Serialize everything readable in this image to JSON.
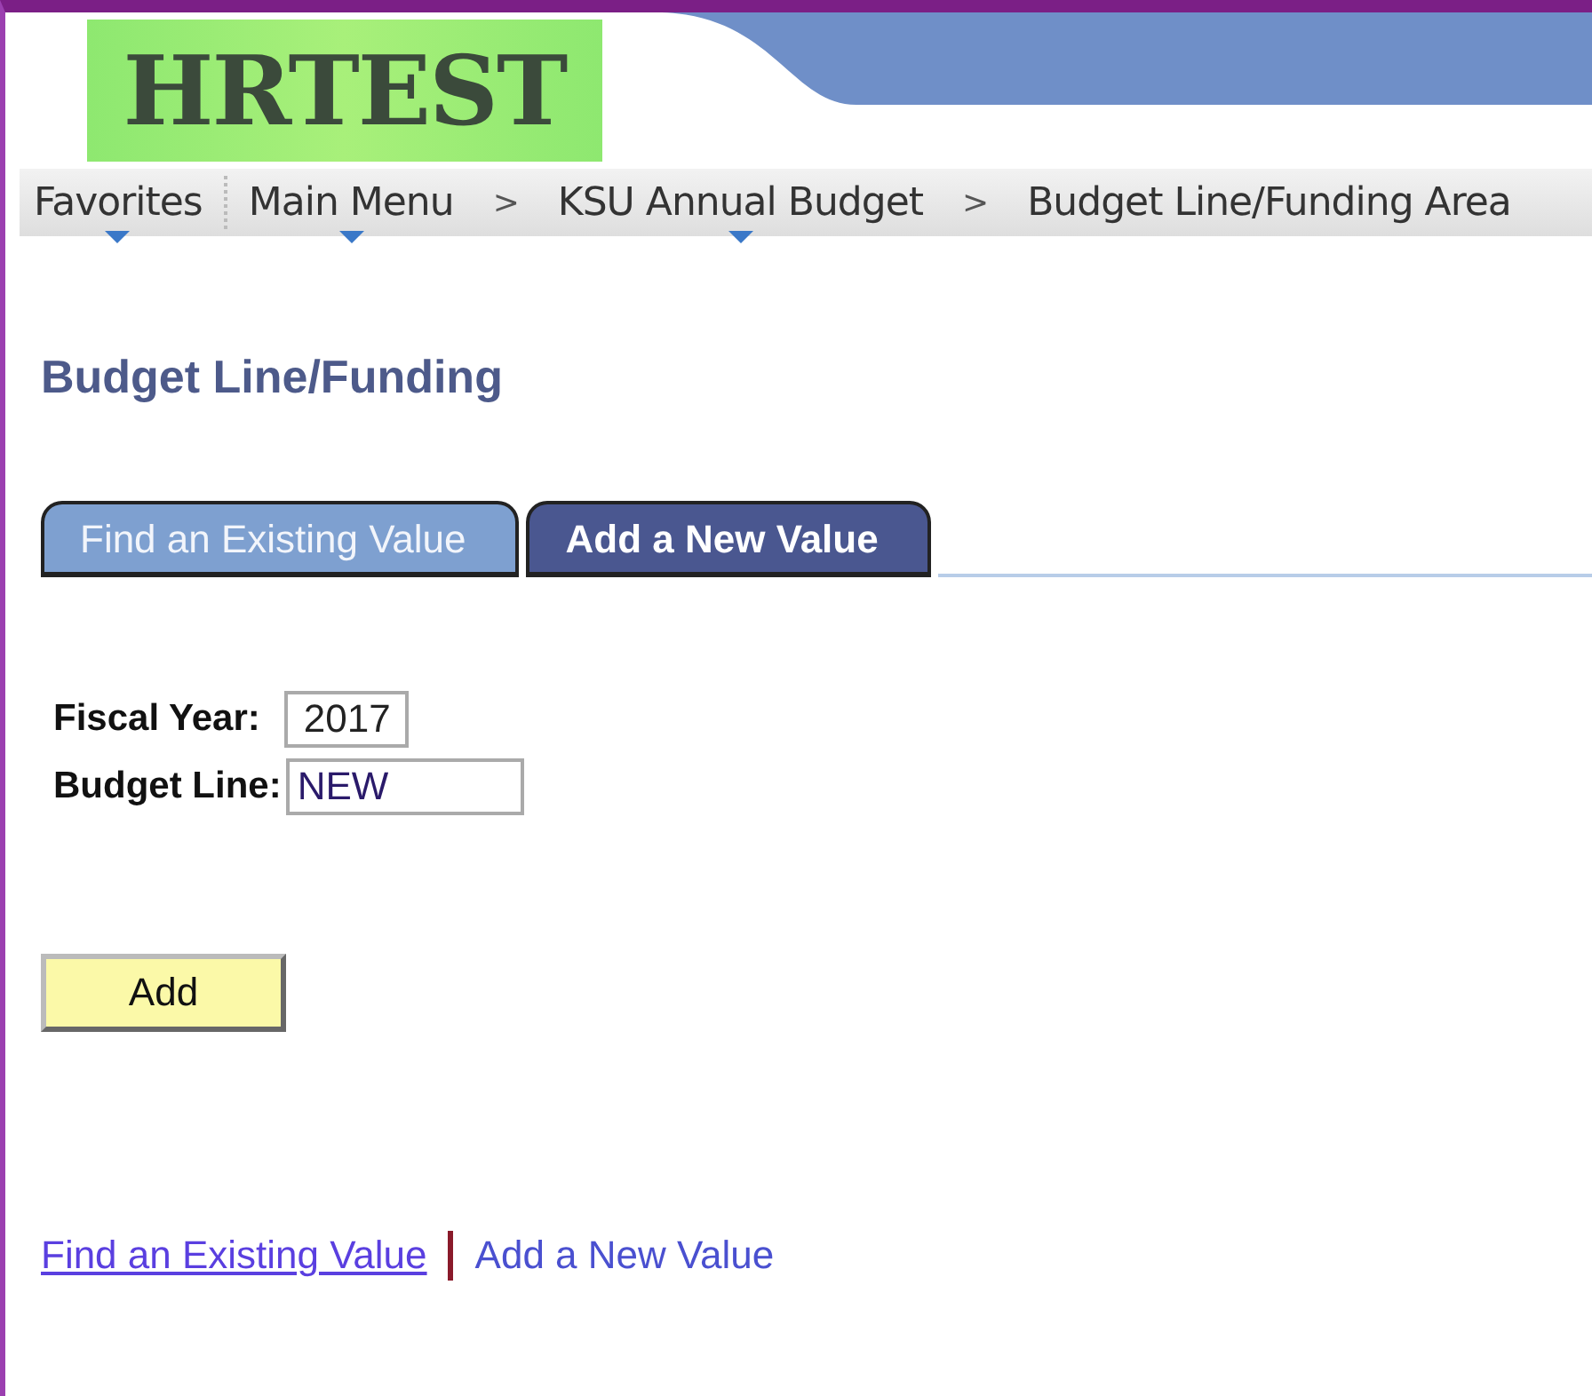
{
  "logo": {
    "text": "HRTEST"
  },
  "breadcrumb": [
    {
      "kind": "item",
      "label": "Favorites",
      "dropdown": true
    },
    {
      "kind": "divider"
    },
    {
      "kind": "item",
      "label": "Main Menu",
      "dropdown": true
    },
    {
      "kind": "separator",
      "label": ">"
    },
    {
      "kind": "item",
      "label": "KSU Annual Budget",
      "dropdown": true
    },
    {
      "kind": "separator",
      "label": ">"
    },
    {
      "kind": "item",
      "label": "Budget Line/Funding Area",
      "dropdown": false
    }
  ],
  "page_title": "Budget Line/Funding",
  "tabs": [
    {
      "label": "Find an Existing Value",
      "selected": false
    },
    {
      "label": "Add a New Value",
      "selected": true
    }
  ],
  "fields": [
    {
      "label": "Fiscal Year:",
      "value": "2017"
    },
    {
      "label": "Budget Line:",
      "value": "NEW"
    }
  ],
  "add_button": "Add",
  "bottom_links": [
    {
      "label": "Find an Existing Value",
      "selected": false
    },
    {
      "label": "Add a New Value",
      "selected": true
    }
  ]
}
